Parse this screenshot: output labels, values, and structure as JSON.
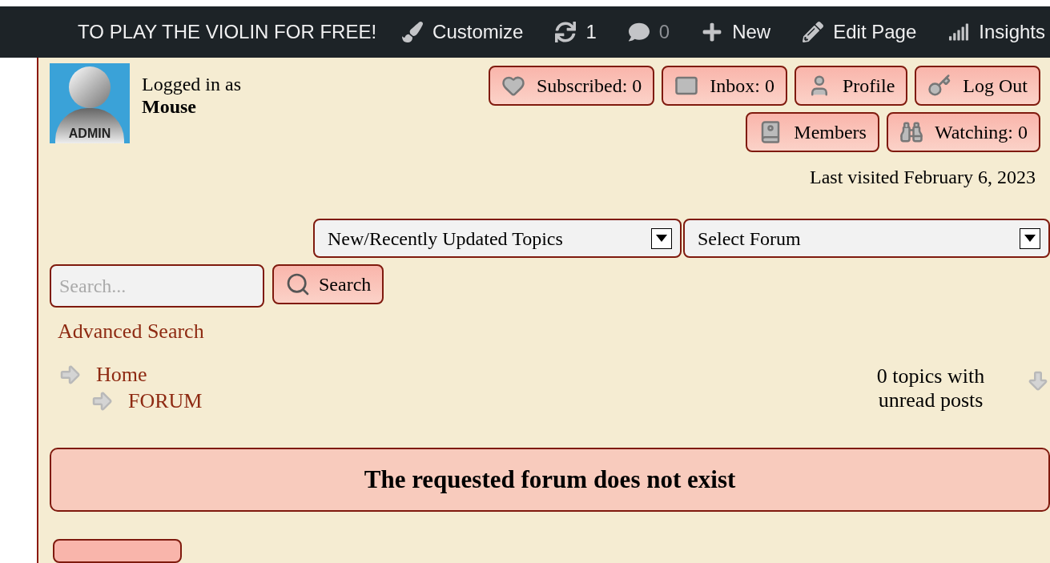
{
  "admin_bar": {
    "site_title": "TO PLAY THE VIOLIN FOR FREE!",
    "items": [
      {
        "label": "Customize",
        "dim": false
      },
      {
        "label": "1",
        "dim": false
      },
      {
        "label": "0",
        "dim": true
      },
      {
        "label": "New",
        "dim": false
      },
      {
        "label": "Edit Page",
        "dim": false
      },
      {
        "label": "Insights",
        "dim": false
      }
    ]
  },
  "user": {
    "logged_in_label": "Logged in as",
    "name": "Mouse",
    "avatar_badge": "ADMIN"
  },
  "user_buttons": [
    [
      {
        "label": "Subscribed: 0"
      },
      {
        "label": "Inbox: 0"
      },
      {
        "label": "Profile"
      },
      {
        "label": "Log Out"
      }
    ],
    [
      {
        "label": "Members"
      },
      {
        "label": "Watching: 0"
      }
    ]
  ],
  "last_visited": "Last visited February 6, 2023",
  "dropdowns": [
    {
      "value": "New/Recently Updated Topics"
    },
    {
      "value": "Select Forum"
    }
  ],
  "search": {
    "placeholder": "Search...",
    "button": "Search",
    "advanced_link": "Advanced Search"
  },
  "breadcrumb": [
    {
      "label": "Home",
      "children": [
        {
          "label": "FORUM"
        }
      ]
    }
  ],
  "unread": "0 topics with unread posts",
  "message": "The requested forum does not exist"
}
